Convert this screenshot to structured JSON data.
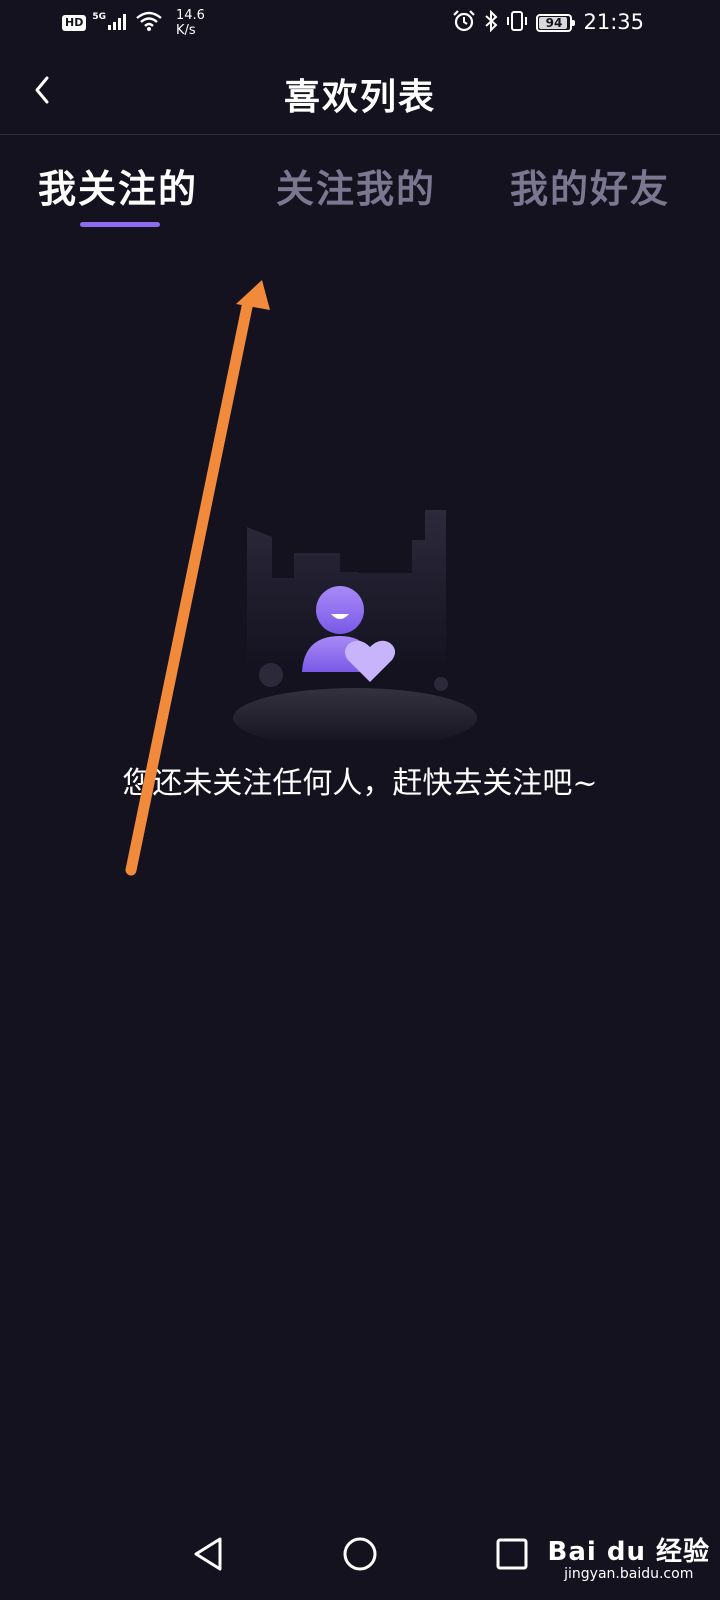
{
  "status_bar": {
    "hd_label": "HD",
    "network_label": "5G",
    "speed_value": "14.6",
    "speed_unit": "K/s",
    "battery_level": "94",
    "time": "21:35"
  },
  "header": {
    "title": "喜欢列表"
  },
  "tabs": [
    {
      "label": "我关注的",
      "active": true
    },
    {
      "label": "关注我的",
      "active": false
    },
    {
      "label": "我的好友",
      "active": false
    }
  ],
  "empty_state": {
    "message": "您还未关注任何人，赶快去关注吧~"
  },
  "watermark": {
    "brand": "Bai du 经验",
    "url": "jingyan.baidu.com"
  },
  "colors": {
    "background": "#14121f",
    "accent": "#8c6cf0",
    "tab_inactive": "#7b7790",
    "annotation_arrow": "#f28a3c"
  }
}
